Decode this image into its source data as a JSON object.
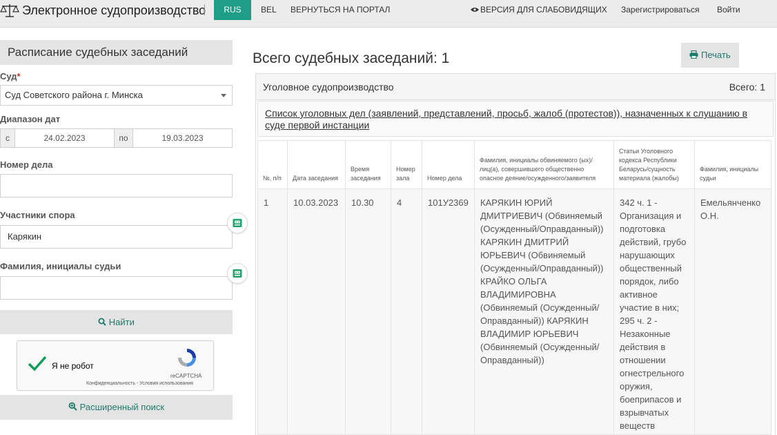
{
  "header": {
    "title": "Электронное судопроизводство",
    "lang_rus": "RUS",
    "lang_bel": "BEL",
    "portal_link": "ВЕРНУТЬСЯ НА ПОРТАЛ",
    "accessibility_link": "ВЕРСИЯ ДЛЯ СЛАБОВИДЯЩИХ",
    "register_link": "Зарегистрироваться",
    "login_link": "Войти",
    "accent_color": "#1f9e87"
  },
  "sidebar": {
    "heading": "Расписание судебных заседаний",
    "court_label": "Суд",
    "court_required_mark": "*",
    "court_value": "Суд Советского района г. Минска",
    "date_range_label": "Диапазон дат",
    "date_from_prefix": "с",
    "date_from": "24.02.2023",
    "date_to_prefix": "по",
    "date_to": "19.03.2023",
    "case_number_label": "Номер дела",
    "case_number_value": "",
    "participants_label": "Участники спора",
    "participants_value": "Карякин",
    "judge_label": "Фамилия, инициалы судьи",
    "judge_value": "",
    "find_button": "Найти",
    "captcha_text": "Я не робот",
    "captcha_brand": "reCAPTCHA",
    "captcha_links": "Конфиденциальность - Условия использования",
    "advanced_search_button": "Расширенный поиск"
  },
  "main": {
    "title": "Всего судебных заседаний: 1",
    "print_button": "Печать",
    "section_title": "Уголовное судопроизводство",
    "section_count": "Всего: 1",
    "list_title": "Список уголовных дел (заявлений, представлений, просьб, жалоб (протестов)), назначенных к слушанию в суде первой инстанции",
    "table": {
      "headers": [
        "№, п/п",
        "Дата заседания",
        "Время заседания",
        "Номер зала",
        "Номер дела",
        "Фамилия, инициалы обвиняемого (ых)/лиц(а), совершившего общественно опасное деяние/осужденного/заявителя",
        "Статьи Уголовного кодекса Республики Беларусь/сущность материала (жалобы)",
        "Фамилия, инициалы судьи"
      ],
      "rows": [
        {
          "num": "1",
          "date": "10.03.2023",
          "time": "10.30",
          "hall": "4",
          "case": "101У2369",
          "persons": "КАРЯКИН ЮРИЙ ДМИТРИЕВИЧ (Обвиняемый (Осужденный/Оправданный)) КАРЯКИН ДМИТРИЙ ЮРЬЕВИЧ (Обвиняемый (Осужденный/Оправданный)) КРАЙКО ОЛЬГА ВЛАДИМИРОВНА (Обвиняемый (Осужденный/Оправданный)) КАРЯКИН ВЛАДИМИР ЮРЬЕВИЧ (Обвиняемый (Осужденный/Оправданный))",
          "articles": "342 ч. 1 - Организация и подготовка действий, грубо нарушающих общественный порядок, либо активное участие в них; 295 ч. 2 - Незаконные действия в отношении огнестрельного оружия, боеприпасов и взрывчатых веществ",
          "judge": "Емельянченко О.Н."
        }
      ]
    }
  }
}
